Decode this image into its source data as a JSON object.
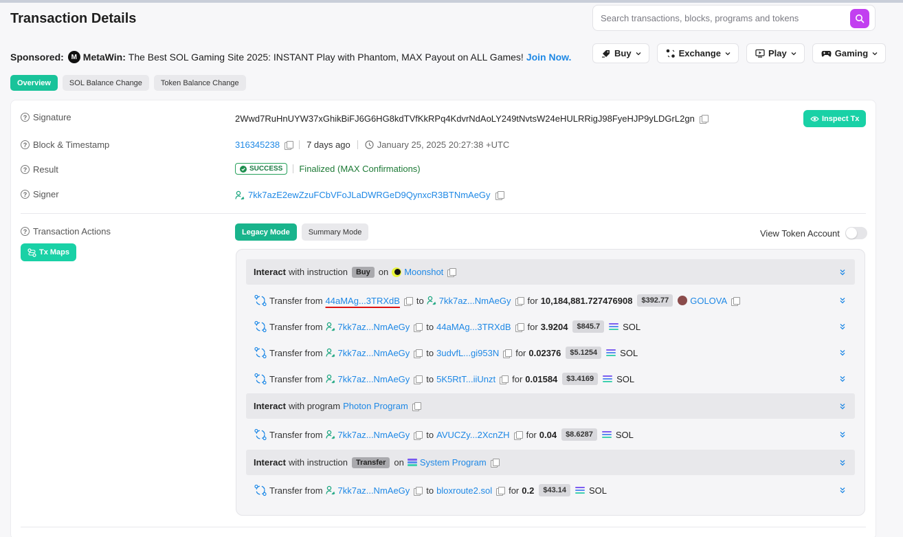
{
  "page": {
    "title": "Transaction Details"
  },
  "search": {
    "placeholder": "Search transactions, blocks, programs and tokens"
  },
  "sponsor": {
    "label": "Sponsored:",
    "brand": "MetaWin:",
    "logo_text": "M",
    "text": "The Best SOL Gaming Site 2025: INSTANT Play with Phantom, MAX Payout on ALL Games!",
    "cta": "Join Now."
  },
  "nav": [
    {
      "label": "Buy",
      "icon": "tag-icon"
    },
    {
      "label": "Exchange",
      "icon": "exchange-icon"
    },
    {
      "label": "Play",
      "icon": "play-icon"
    },
    {
      "label": "Gaming",
      "icon": "gamepad-icon"
    }
  ],
  "tabs": [
    "Overview",
    "SOL Balance Change",
    "Token Balance Change"
  ],
  "details": {
    "signature_label": "Signature",
    "signature": "2Wwd7RuHnUYW37xGhikBiFJ6G6HG8kdTVfKkRPq4KdvrNdAoLY249tNvtsW24eHULRRigJ98FyeHJP9yLDGrL2gn",
    "inspect_label": "Inspect Tx",
    "block_label": "Block & Timestamp",
    "block": "316345238",
    "ago": "7 days ago",
    "timestamp": "January 25, 2025 20:27:38 +UTC",
    "result_label": "Result",
    "result_status": "SUCCESS",
    "result_text": "Finalized (MAX Confirmations)",
    "signer_label": "Signer",
    "signer": "7kk7azE2ewZzuFCbVFoJLaDWRGeD9QynxcR3BTNmAeGy",
    "actions_label": "Transaction Actions",
    "txmaps_label": "Tx Maps"
  },
  "modes": [
    "Legacy Mode",
    "Summary Mode"
  ],
  "view_token_account": "View Token Account",
  "common": {
    "interact": "Interact",
    "transfer_from": "Transfer from",
    "to": "to",
    "for": "for",
    "on": "on"
  },
  "groups": [
    {
      "mid": "with instruction",
      "badge": "Buy",
      "program": "Moonshot"
    },
    {
      "mid": "with program",
      "program": "Photon Program"
    },
    {
      "mid": "with instruction",
      "badge": "Transfer",
      "program": "System Program"
    }
  ],
  "transfers": [
    {
      "from": "44aMAg...3TRXdB",
      "to": "7kk7az...NmAeGy",
      "amount": "10,184,881.727476908",
      "usd": "$392.77",
      "token": "GOLOVA"
    },
    {
      "from": "7kk7az...NmAeGy",
      "to": "44aMAg...3TRXdB",
      "amount": "3.9204",
      "usd": "$845.7",
      "token": "SOL"
    },
    {
      "from": "7kk7az...NmAeGy",
      "to": "3udvfL...gi953N",
      "amount": "0.02376",
      "usd": "$5.1254",
      "token": "SOL"
    },
    {
      "from": "7kk7az...NmAeGy",
      "to": "5K5RtT...iiUnzt",
      "amount": "0.01584",
      "usd": "$3.4169",
      "token": "SOL"
    },
    {
      "from": "7kk7az...NmAeGy",
      "to": "AVUCZy...2XcnZH",
      "amount": "0.04",
      "usd": "$8.6287",
      "token": "SOL"
    },
    {
      "from": "7kk7az...NmAeGy",
      "to": "bloxroute2.sol",
      "amount": "0.2",
      "usd": "$43.14",
      "token": "SOL"
    }
  ],
  "colors": {
    "accent": "#19c39a",
    "link": "#1e88e5",
    "search_button": "#c23ff0",
    "success": "#1d7a36"
  }
}
